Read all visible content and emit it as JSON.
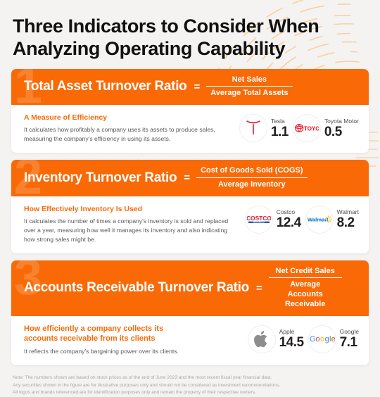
{
  "title": "Three Indicators to Consider When Analyzing Operating Capability",
  "colors": {
    "accent_orange": "#f96a07",
    "background": "#f4f3f1",
    "card_white": "#ffffff",
    "title_black": "#111111",
    "body_gray": "#57585a",
    "note_gray": "#a9a7a5"
  },
  "cards": [
    {
      "number": "1",
      "ratio_name": "Total Asset Turnover Ratio",
      "equals": "=",
      "formula_numerator": "Net Sales",
      "formula_denominator": "Average Total Assets",
      "desc_heading": "A Measure of Efficiency",
      "desc_body": "It calculates how profitably a company uses its assets to produce sales, measuring the company's efficiency in using its assets.",
      "companies": [
        {
          "logo": "tesla-logo-icon",
          "name": "Tesla",
          "value": "1.1"
        },
        {
          "logo": "toyota-logo-icon",
          "name": "Toyota Motor",
          "value": "0.5"
        }
      ]
    },
    {
      "number": "2",
      "ratio_name": "Inventory Turnover Ratio",
      "equals": "=",
      "formula_numerator": "Cost of Goods Sold (COGS)",
      "formula_denominator": "Average Inventory",
      "desc_heading": "How Effectively Inventory Is Used",
      "desc_body": "It calculates the number of times a company's inventory is sold and replaced over a year, measuring how well it manages its inventory and also indicating how strong sales might be.",
      "companies": [
        {
          "logo": "costco-logo-icon",
          "name": "Costco",
          "value": "12.4"
        },
        {
          "logo": "walmart-logo-icon",
          "name": "Walmart",
          "value": "8.2"
        }
      ]
    },
    {
      "number": "3",
      "ratio_name": "Accounts Receivable Turnover Ratio",
      "equals": "=",
      "formula_numerator": "Net Credit Sales",
      "formula_denominator": "Average Accounts Receivable",
      "desc_heading": "How efficiently a company collects its accounts receivable from its clients",
      "desc_body": "It reflects the company's bargaining power over its clients.",
      "companies": [
        {
          "logo": "apple-logo-icon",
          "name": "Apple",
          "value": "14.5"
        },
        {
          "logo": "google-logo-icon",
          "name": "Google",
          "value": "7.1"
        }
      ]
    }
  ],
  "note": {
    "line1": "Note: The numbers shown are based on stock prices as of the end of June 2023 and the most recent fiscal year financial data.",
    "line2": "Any securities shown in the figure are for illustrative purposes only and should not be considered as investment recommendations.",
    "line3": "All logos and brands referenced are for identification purposes only and remain the property of their respective owners."
  }
}
